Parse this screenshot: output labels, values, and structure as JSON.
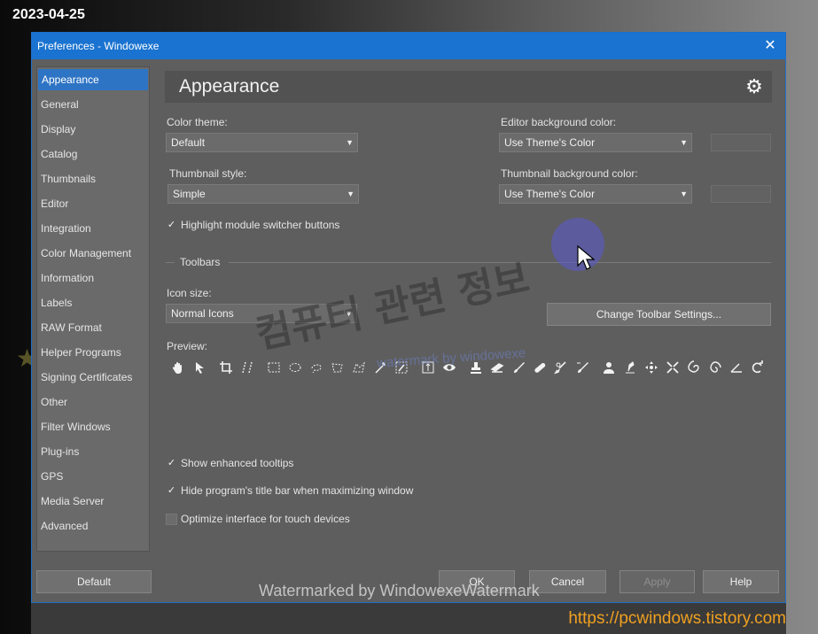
{
  "overlay": {
    "date": "2023-04-25",
    "url": "https://pcwindows.tistory.com",
    "watermark_korean": "컴퓨터 관련 정보",
    "watermark_mid": "watermark by windowexe",
    "watermark_bottom": "Watermarked by WindowexeWatermark"
  },
  "window": {
    "title": "Preferences   - Windowexe",
    "close_glyph": "✕"
  },
  "sidebar": {
    "items": [
      {
        "label": "Appearance",
        "active": true
      },
      {
        "label": "General"
      },
      {
        "label": "Display"
      },
      {
        "label": "Catalog"
      },
      {
        "label": "Thumbnails"
      },
      {
        "label": "Editor"
      },
      {
        "label": "Integration"
      },
      {
        "label": "Color Management"
      },
      {
        "label": "Information"
      },
      {
        "label": "Labels"
      },
      {
        "label": "RAW Format"
      },
      {
        "label": "Helper Programs"
      },
      {
        "label": "Signing Certificates"
      },
      {
        "label": "Other"
      },
      {
        "label": "Filter Windows"
      },
      {
        "label": "Plug-ins"
      },
      {
        "label": "GPS"
      },
      {
        "label": "Media Server"
      },
      {
        "label": "Advanced"
      }
    ]
  },
  "panel": {
    "title": "Appearance",
    "gear_icon": "gear-icon",
    "color_theme": {
      "label": "Color theme:",
      "value": "Default"
    },
    "thumbnail_style": {
      "label": "Thumbnail style:",
      "value": "Simple"
    },
    "editor_bg": {
      "label": "Editor background color:",
      "value": "Use Theme's Color"
    },
    "thumb_bg": {
      "label": "Thumbnail background color:",
      "value": "Use Theme's Color"
    },
    "highlight_switcher": {
      "label": "Highlight module switcher buttons",
      "checked": true
    },
    "toolbars_section": "Toolbars",
    "icon_size": {
      "label": "Icon size:",
      "value": "Normal Icons"
    },
    "change_toolbar_button": "Change Toolbar Settings...",
    "preview_label": "Preview:",
    "enhanced_tooltips": {
      "label": "Show enhanced tooltips",
      "checked": true
    },
    "hide_title_bar": {
      "label": "Hide program's title bar when maximizing window",
      "checked": true
    },
    "touch_devices": {
      "label": "Optimize interface for touch devices",
      "checked": false
    }
  },
  "footer": {
    "default": "Default",
    "ok": "OK",
    "cancel": "Cancel",
    "apply": "Apply",
    "help": "Help"
  },
  "colors": {
    "accent": "#1a73d0",
    "selection": "#2e74c4",
    "url_text": "#f0a020"
  }
}
